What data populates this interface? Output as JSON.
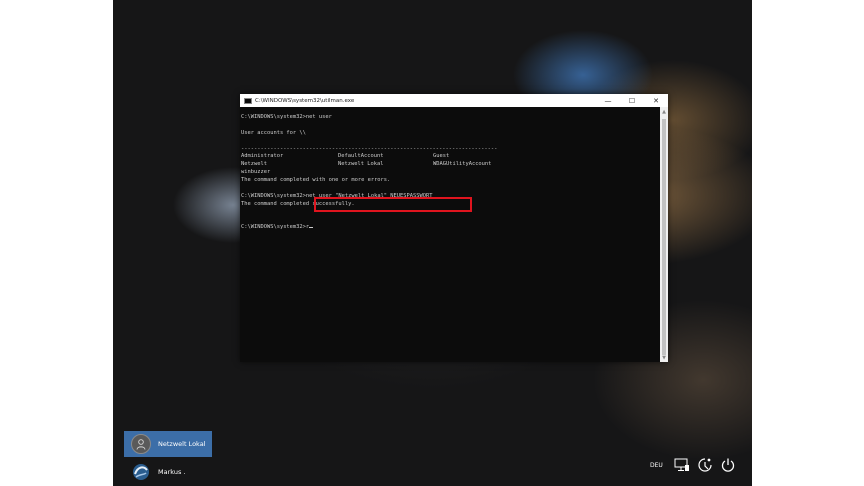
{
  "window": {
    "title": "C:\\WINDOWS\\system32\\utilman.exe",
    "minimize": "—",
    "maximize": "☐",
    "close": "✕"
  },
  "console": {
    "l1": "C:\\WINDOWS\\system32>net user",
    "l2": "User accounts for \\\\",
    "l3": "-------------------------------------------------------------------------------",
    "accounts": {
      "r1c1": "Administrator",
      "r1c2": "DefaultAccount",
      "r1c3": "Guest",
      "r2c1": "Netzwelt",
      "r2c2": "Netzwelt Lokal",
      "r2c3": "WDAGUtilityAccount",
      "r3c1": "winbuzzer"
    },
    "l7": "The command completed with one or more errors.",
    "l8_prompt": "C:\\WINDOWS\\system32>",
    "l8_cmd": "net user \"Netzwelt Lokal\" NEUESPASSWORT",
    "l9": "The command completed successfully.",
    "l10_prompt": "C:\\WINDOWS\\system32>",
    "l10_input": "r"
  },
  "users": {
    "selected": "Netzwelt Lokal",
    "second": "Markus ."
  },
  "tray": {
    "language": "DEU"
  },
  "colors": {
    "highlight": "#e0141e",
    "selected_user_bg": "#3c6ea8",
    "console_bg": "#0c0c0c",
    "console_text": "#cccccc"
  }
}
